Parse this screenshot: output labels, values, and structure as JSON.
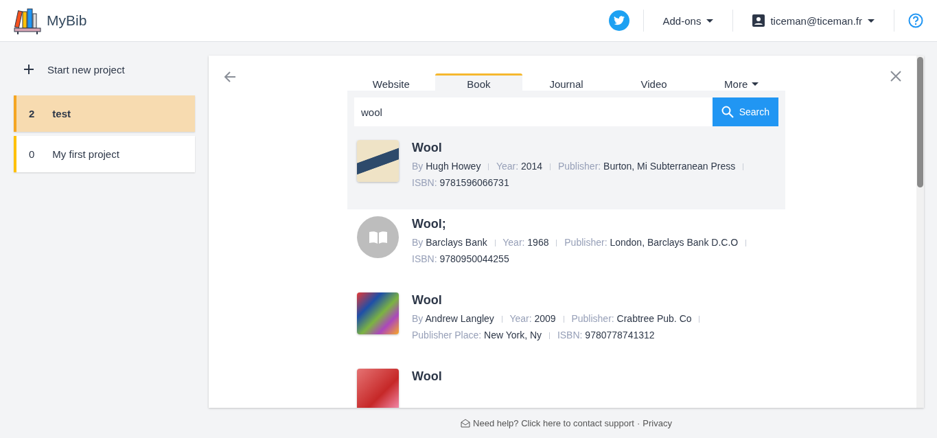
{
  "header": {
    "brand": "MyBib",
    "addons": "Add-ons",
    "account": "ticeman@ticeman.fr"
  },
  "sidebar": {
    "new_project": "Start new project",
    "projects": [
      {
        "count": "2",
        "name": "test",
        "selected": true
      },
      {
        "count": "0",
        "name": "My first project",
        "selected": false
      }
    ]
  },
  "tabs": [
    {
      "label": "Website",
      "selected": false,
      "dropdown": false
    },
    {
      "label": "Book",
      "selected": true,
      "dropdown": false
    },
    {
      "label": "Journal",
      "selected": false,
      "dropdown": false
    },
    {
      "label": "Video",
      "selected": false,
      "dropdown": false
    },
    {
      "label": "More",
      "selected": false,
      "dropdown": true
    }
  ],
  "search": {
    "value": "wool",
    "button": "Search"
  },
  "results": [
    {
      "title": "Wool",
      "kind": "cover",
      "selected": true,
      "fields": [
        {
          "label": "By",
          "value": "Hugh Howey"
        },
        {
          "label": "Year:",
          "value": "2014"
        },
        {
          "label": "Publisher:",
          "value": "Burton, Mi Subterranean Press"
        },
        {
          "label": "ISBN:",
          "value": "9781596066731"
        }
      ]
    },
    {
      "title": "Wool;",
      "kind": "placeholder",
      "selected": false,
      "fields": [
        {
          "label": "By",
          "value": "Barclays Bank"
        },
        {
          "label": "Year:",
          "value": "1968"
        },
        {
          "label": "Publisher:",
          "value": "London, Barclays Bank D.C.O"
        },
        {
          "label": "ISBN:",
          "value": "9780950044255"
        }
      ]
    },
    {
      "title": "Wool",
      "kind": "cover",
      "selected": false,
      "fields": [
        {
          "label": "By",
          "value": "Andrew Langley"
        },
        {
          "label": "Year:",
          "value": "2009"
        },
        {
          "label": "Publisher:",
          "value": "Crabtree Pub. Co"
        },
        {
          "label": "Publisher Place:",
          "value": "New York, Ny"
        },
        {
          "label": "ISBN:",
          "value": "9780778741312"
        }
      ]
    },
    {
      "title": "Wool",
      "kind": "cover",
      "selected": false
    }
  ],
  "footer": {
    "help": "Need help? Click here to contact support",
    "separator": "·",
    "privacy": "Privacy"
  }
}
